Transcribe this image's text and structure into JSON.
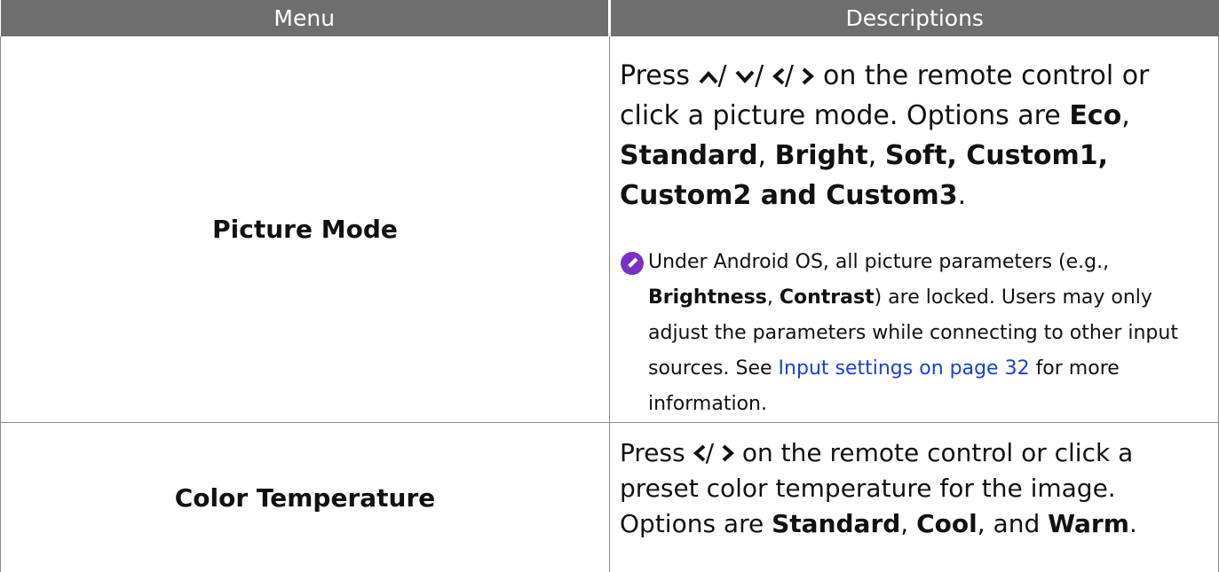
{
  "table": {
    "headers": {
      "menu": "Menu",
      "descriptions": "Descriptions"
    },
    "rows": [
      {
        "menu": "Picture Mode",
        "desc": {
          "press": "Press",
          "nav_keys": [
            "up-arrow-icon",
            "down-arrow-icon",
            "left-arrow-icon",
            "right-arrow-icon"
          ],
          "after_keys": "on the remote control or click a picture mode. Options are",
          "opt1": "Eco",
          "opt2": "Standard",
          "opt3": "Bright",
          "opt4": "Soft, Custom1,",
          "opt5": "Custom2 and Custom3",
          "end": "."
        },
        "note": {
          "icon": "pencil-note-icon",
          "text1": "Under Android OS, all picture parameters (e.g.,",
          "bold1": "Brightness",
          "bold2": "Contrast",
          "text2": ") are locked. Users may only adjust the parameters while connecting to other input sources. See",
          "link": "Input settings on page 32",
          "text3": "for more information."
        }
      },
      {
        "menu": "Color Temperature",
        "desc": {
          "press": "Press",
          "nav_keys": [
            "left-arrow-icon",
            "right-arrow-icon"
          ],
          "after_keys": "on the remote control or click a preset color temperature for the image. Options are",
          "opt1": "Standard",
          "opt2": "Cool",
          "and": "and",
          "opt3": "Warm",
          "end": "."
        }
      }
    ]
  },
  "colors": {
    "header_bg": "#6e6e6e",
    "header_text": "#ffffff",
    "link": "#1a3fd6",
    "note_icon": "#7b2fc9"
  }
}
